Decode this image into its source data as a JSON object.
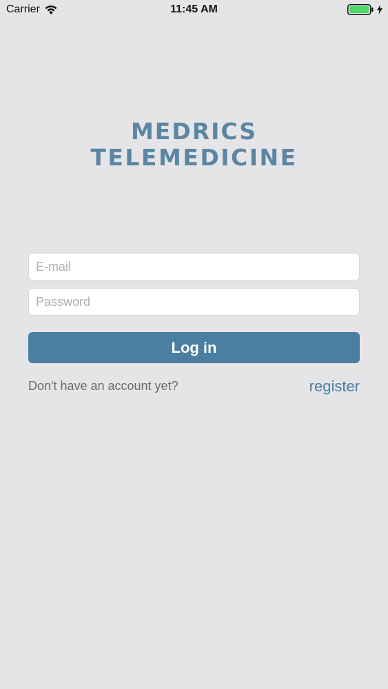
{
  "status_bar": {
    "carrier": "Carrier",
    "time": "11:45 AM"
  },
  "logo": {
    "line1": "MEDRICS",
    "line2": "TELEMEDICINE"
  },
  "login_form": {
    "email_placeholder": "E-mail",
    "password_placeholder": "Password",
    "email_value": "",
    "password_value": "",
    "login_label": "Log in"
  },
  "footer": {
    "no_account_text": "Don't have an account yet?",
    "register_label": "register"
  },
  "colors": {
    "background": "#e5e5e7",
    "accent": "#4a7fa1",
    "logo": "#5b86a3",
    "battery": "#4cd964"
  }
}
